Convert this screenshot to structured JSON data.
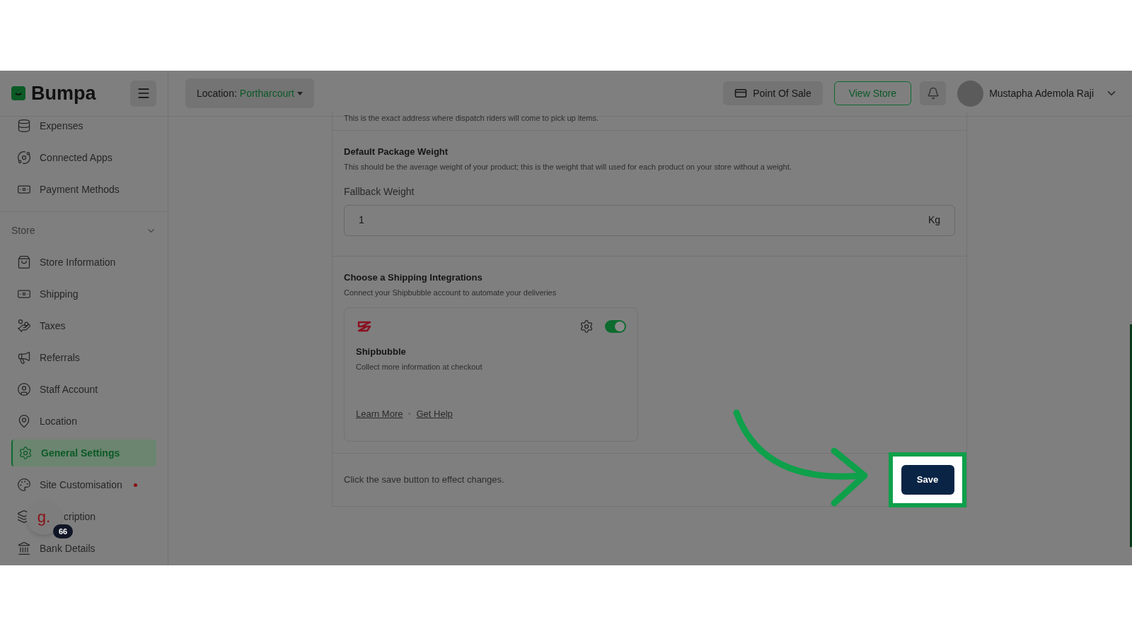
{
  "brand": {
    "name": "Bumpa"
  },
  "location": {
    "label": "Location:",
    "value": "Portharcourt"
  },
  "header_actions": {
    "pos": "Point Of Sale",
    "view_store": "View Store",
    "user": "Mustapha Ademola Raji"
  },
  "sidebar": {
    "top_items": [
      {
        "label": "Expenses",
        "selected": false
      },
      {
        "label": "Connected Apps",
        "selected": false
      },
      {
        "label": "Payment Methods",
        "selected": false
      }
    ],
    "section": {
      "label": "Store",
      "expanded": true,
      "items": [
        {
          "label": "Store Information",
          "selected": false,
          "dot": false
        },
        {
          "label": "Shipping",
          "selected": false,
          "dot": false
        },
        {
          "label": "Taxes",
          "selected": false,
          "dot": false
        },
        {
          "label": "Referrals",
          "selected": false,
          "dot": false
        },
        {
          "label": "Staff Account",
          "selected": false,
          "dot": false
        },
        {
          "label": "Location",
          "selected": false,
          "dot": false
        },
        {
          "label": "General Settings",
          "selected": true,
          "dot": false
        },
        {
          "label": "Site Customisation",
          "selected": false,
          "dot": true
        },
        {
          "label": "cription",
          "selected": false,
          "dot": false
        },
        {
          "label": "Bank Details",
          "selected": false,
          "dot": false
        }
      ]
    }
  },
  "widget": {
    "letter": "g.",
    "count": "66"
  },
  "content": {
    "address_note": "This is the exact address where dispatch riders will come to pick up items.",
    "weight": {
      "title": "Default Package Weight",
      "description": "This should be the average weight of your product; this is the weight that will used for each product on your store without a weight.",
      "field_label": "Fallback Weight",
      "value": "1",
      "unit": "Kg"
    },
    "integrations": {
      "title": "Choose a Shipping Integrations",
      "description": "Connect your Shipbubble account to automate your deliveries",
      "cards": [
        {
          "name": "Shipbubble",
          "description": "Collect more information at checkout",
          "on": true,
          "links": [
            "Learn More",
            "Get Help"
          ]
        }
      ]
    },
    "footer": {
      "note": "Click the save button to effect changes.",
      "save": "Save",
      "highlighted": true
    }
  }
}
